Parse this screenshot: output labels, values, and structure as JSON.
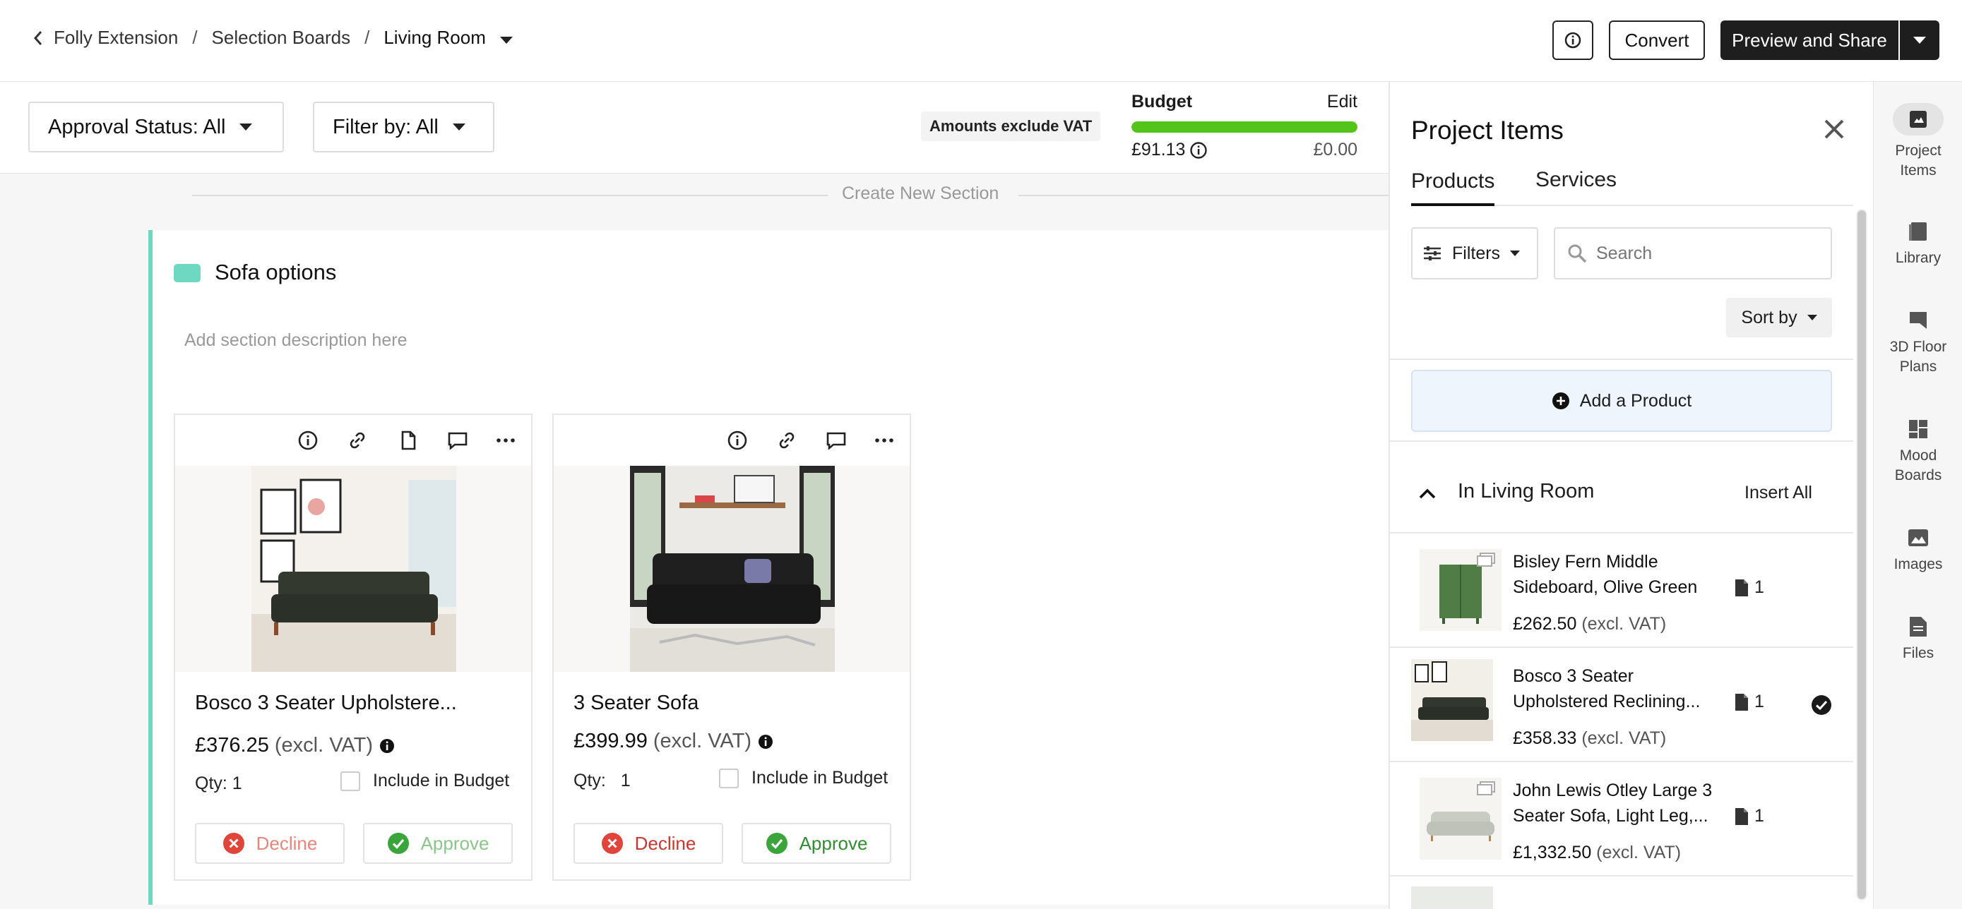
{
  "breadcrumb": {
    "items": [
      "Folly Extension",
      "Selection Boards",
      "Living Room"
    ],
    "separator": "/"
  },
  "header": {
    "convert_label": "Convert",
    "preview_label": "Preview and Share"
  },
  "filters": {
    "approval_label": "Approval Status: All",
    "filter_label": "Filter by: All",
    "vat_note": "Amounts exclude VAT"
  },
  "budget": {
    "label": "Budget",
    "edit_label": "Edit",
    "spent": "£91.13",
    "remaining": "£0.00",
    "progress_fraction": 1.0,
    "bar_color": "#52c41a"
  },
  "board": {
    "create_section_label": "Create New Section",
    "section": {
      "title": "Sofa options",
      "description_placeholder": "Add section description here",
      "color": "#6ed8c0"
    },
    "cards": [
      {
        "title": "Bosco 3 Seater Upholstere...",
        "price": "£376.25",
        "price_note": "(excl. VAT)",
        "qty_label": "Qty:",
        "qty": "1",
        "include_label": "Include in Budget",
        "decline_label": "Decline",
        "approve_label": "Approve",
        "icons": [
          "info-icon",
          "link-icon",
          "file-icon",
          "comment-icon",
          "more-icon"
        ]
      },
      {
        "title": "3 Seater Sofa",
        "price": "£399.99",
        "price_note": "(excl. VAT)",
        "qty_label": "Qty:",
        "qty": "1",
        "include_label": "Include in Budget",
        "decline_label": "Decline",
        "approve_label": "Approve",
        "icons": [
          "info-icon",
          "link-icon",
          "comment-icon",
          "more-icon"
        ]
      }
    ]
  },
  "panel": {
    "title": "Project Items",
    "tabs": [
      "Products",
      "Services"
    ],
    "active_tab": "Products",
    "filters_label": "Filters",
    "search_placeholder": "Search",
    "sort_label": "Sort by",
    "add_product_label": "Add a Product",
    "group_title": "In Living Room",
    "insert_all_label": "Insert All",
    "products": [
      {
        "name": "Bisley Fern Middle Sideboard, Olive Green",
        "price": "£262.50",
        "price_note": "(excl. VAT)",
        "files": "1",
        "selected": false
      },
      {
        "name": "Bosco 3 Seater Upholstered Reclining...",
        "price": "£358.33",
        "price_note": "(excl. VAT)",
        "files": "1",
        "selected": true
      },
      {
        "name": "John Lewis Otley Large 3 Seater Sofa, Light Leg,...",
        "price": "£1,332.50",
        "price_note": "(excl. VAT)",
        "files": "1",
        "selected": false
      }
    ]
  },
  "rail": {
    "items": [
      "Project Items",
      "Library",
      "3D Floor Plans",
      "Mood Boards",
      "Images",
      "Files"
    ],
    "active": "Project Items"
  },
  "colors": {
    "decline": "#e0443a",
    "approve": "#3aa53a",
    "dark": "#1e1e1e",
    "add_product_bg": "#eef5fc"
  }
}
